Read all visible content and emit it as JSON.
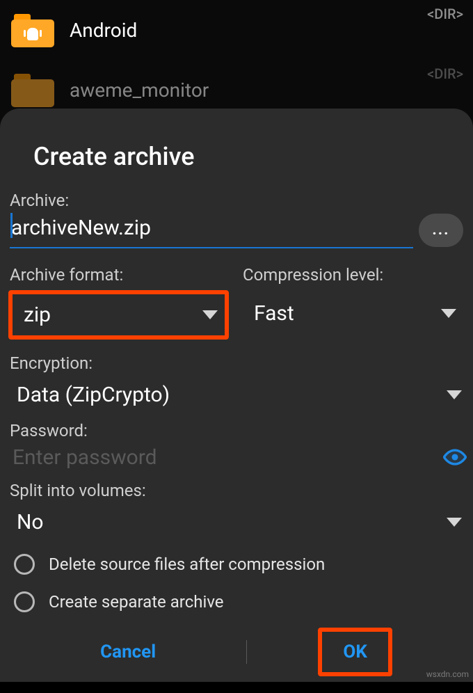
{
  "filelist": {
    "items": [
      {
        "label": "Android",
        "dir_tag": "<DIR>"
      },
      {
        "label": "aweme_monitor",
        "dir_tag": "<DIR>"
      }
    ]
  },
  "dialog": {
    "title": "Create archive",
    "archive_label": "Archive:",
    "archive_value": "archiveNew.zip",
    "ellipsis": "...",
    "format_label": "Archive format:",
    "format_value": "zip",
    "level_label": "Compression level:",
    "level_value": "Fast",
    "encryption_label": "Encryption:",
    "encryption_value": "Data (ZipCrypto)",
    "password_label": "Password:",
    "password_placeholder": "Enter password",
    "split_label": "Split into volumes:",
    "split_value": "No",
    "delete_source_label": "Delete source files after compression",
    "separate_archive_label": "Create separate archive",
    "cancel": "Cancel",
    "ok": "OK"
  },
  "watermark": "wsxdn.com",
  "colors": {
    "accent": "#2196f3",
    "highlight_border": "#ff4100",
    "dialog_bg": "#2c2c2c",
    "folder": "#ffa726"
  }
}
